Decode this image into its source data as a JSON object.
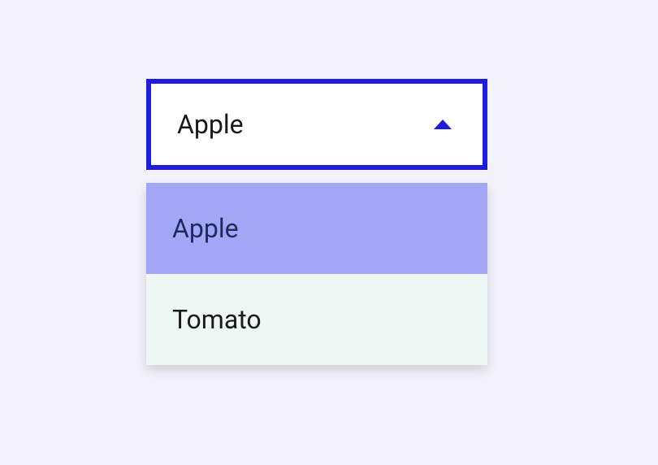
{
  "dropdown": {
    "selected": "Apple",
    "options": [
      {
        "label": "Apple",
        "highlighted": true
      },
      {
        "label": "Tomato",
        "highlighted": false
      }
    ]
  },
  "colors": {
    "accent": "#1f1bdf",
    "highlight_bg": "#a3a6f6",
    "list_bg": "#eef7f4",
    "page_bg": "#f3f2fb"
  }
}
